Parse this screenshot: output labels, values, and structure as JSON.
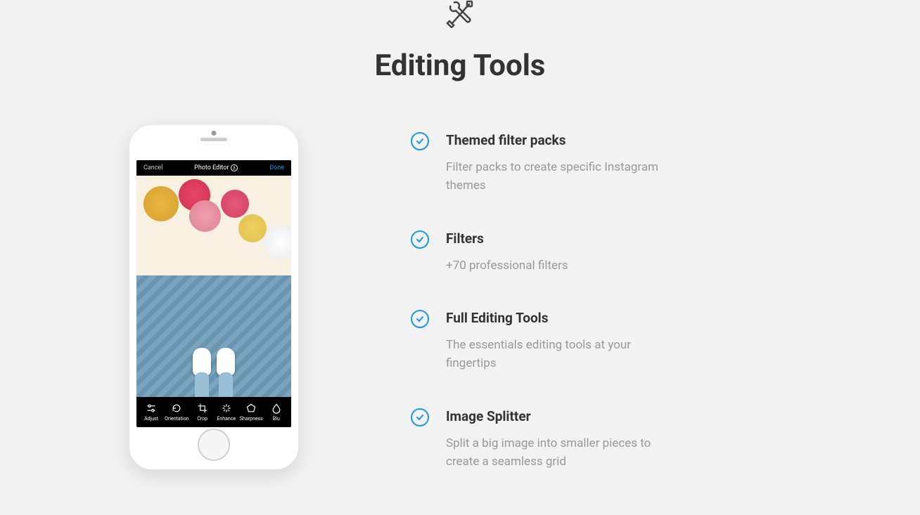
{
  "header": {
    "title": "Editing Tools"
  },
  "phone": {
    "nav": {
      "cancel": "Cancel",
      "title": "Photo Editor",
      "done": "Done"
    },
    "tools": [
      {
        "label": "Adjust"
      },
      {
        "label": "Orientation"
      },
      {
        "label": "Crop"
      },
      {
        "label": "Enhance"
      },
      {
        "label": "Sharpness"
      },
      {
        "label": "Blu"
      }
    ]
  },
  "features": [
    {
      "title": "Themed filter packs",
      "description": "Filter packs to create specific Instagram themes"
    },
    {
      "title": "Filters",
      "description": "+70 professional filters"
    },
    {
      "title": "Full Editing Tools",
      "description": "The essentials editing tools at your fingertips"
    },
    {
      "title": "Image Splitter",
      "description": "Split a big image into smaller pieces to create a seamless grid"
    }
  ]
}
